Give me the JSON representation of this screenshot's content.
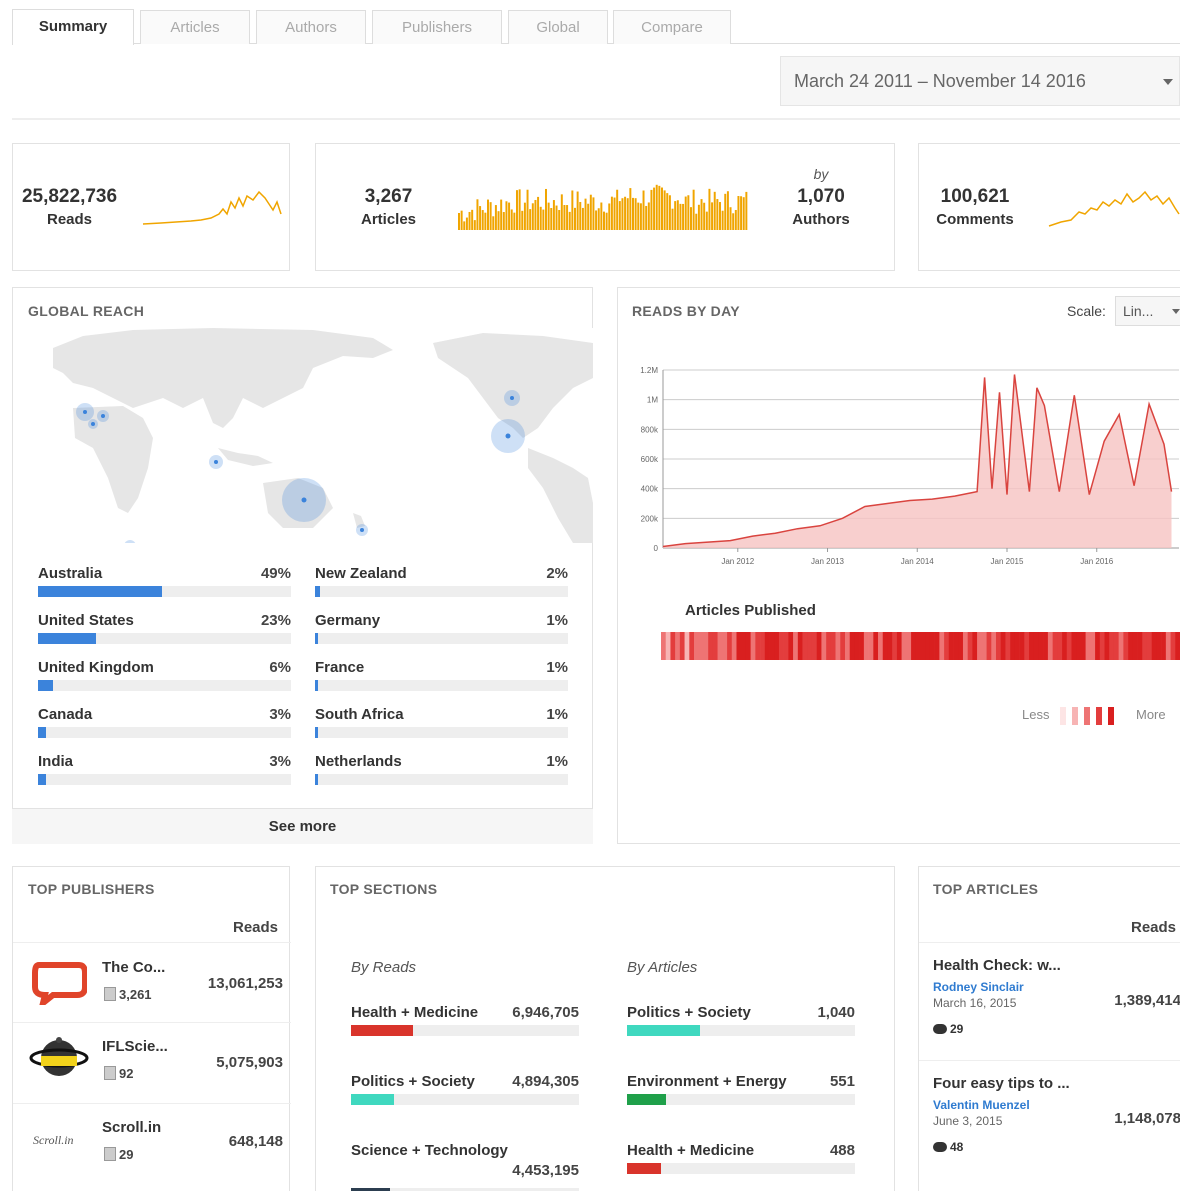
{
  "tabs": [
    "Summary",
    "Articles",
    "Authors",
    "Publishers",
    "Global",
    "Compare"
  ],
  "date_range": "March 24 2011 – November 14 2016",
  "summary": {
    "reads": {
      "value": "25,822,736",
      "label": "Reads"
    },
    "articles": {
      "value": "3,267",
      "label": "Articles"
    },
    "authors": {
      "by": "by",
      "value": "1,070",
      "label": "Authors"
    },
    "comments": {
      "value": "100,621",
      "label": "Comments"
    }
  },
  "colors": {
    "accent_orange": "#f0a500",
    "reads_red": "#d9443f",
    "bar_blue": "#3b83db"
  },
  "global_reach": {
    "title": "GLOBAL REACH",
    "countries": [
      {
        "name": "Australia",
        "pct": "49%",
        "value": 49
      },
      {
        "name": "United States",
        "pct": "23%",
        "value": 23
      },
      {
        "name": "United Kingdom",
        "pct": "6%",
        "value": 6
      },
      {
        "name": "Canada",
        "pct": "3%",
        "value": 3
      },
      {
        "name": "India",
        "pct": "3%",
        "value": 3
      },
      {
        "name": "New Zealand",
        "pct": "2%",
        "value": 2
      },
      {
        "name": "Germany",
        "pct": "1%",
        "value": 1
      },
      {
        "name": "France",
        "pct": "1%",
        "value": 1
      },
      {
        "name": "South Africa",
        "pct": "1%",
        "value": 1
      },
      {
        "name": "Netherlands",
        "pct": "1%",
        "value": 1
      }
    ],
    "see_more": "See more"
  },
  "reads_by_day": {
    "title": "READS BY DAY",
    "scale_label": "Scale:",
    "scale_value": "Lin...",
    "articles_published": "Articles Published",
    "legend_less": "Less",
    "legend_more": "More"
  },
  "chart_data": {
    "type": "area",
    "title": "READS BY DAY",
    "y_ticks": [
      "0",
      "200k",
      "400k",
      "600k",
      "800k",
      "1M",
      "1.2M"
    ],
    "x_ticks": [
      "Jan 2012",
      "Jan 2013",
      "Jan 2014",
      "Jan 2015",
      "Jan 2016"
    ],
    "ylim": [
      0,
      1200000
    ],
    "x": [
      "2011-03",
      "2011-06",
      "2011-09",
      "2011-12",
      "2012-03",
      "2012-06",
      "2012-09",
      "2012-12",
      "2013-03",
      "2013-06",
      "2013-09",
      "2013-12",
      "2014-03",
      "2014-06",
      "2014-09",
      "2014-10",
      "2014-11",
      "2014-12",
      "2015-01",
      "2015-02",
      "2015-04",
      "2015-05",
      "2015-06",
      "2015-08",
      "2015-10",
      "2015-12",
      "2016-02",
      "2016-04",
      "2016-06",
      "2016-08",
      "2016-10",
      "2016-11"
    ],
    "values": [
      10000,
      30000,
      40000,
      50000,
      80000,
      100000,
      130000,
      150000,
      200000,
      280000,
      300000,
      320000,
      330000,
      350000,
      380000,
      1150000,
      400000,
      1050000,
      360000,
      1170000,
      380000,
      1080000,
      960000,
      380000,
      1030000,
      360000,
      720000,
      900000,
      420000,
      970000,
      700000,
      380000
    ]
  },
  "top_publishers": {
    "title": "TOP PUBLISHERS",
    "reads_header": "Reads",
    "items": [
      {
        "name": "The Co...",
        "count": "3,261",
        "reads": "13,061,253"
      },
      {
        "name": "IFLScie...",
        "count": "92",
        "reads": "5,075,903"
      },
      {
        "name": "Scroll.in",
        "count": "29",
        "reads": "648,148",
        "logo_text": "Scroll.in"
      }
    ]
  },
  "top_sections": {
    "title": "TOP SECTIONS",
    "by_reads_label": "By Reads",
    "by_articles_label": "By Articles",
    "by_reads": [
      {
        "name": "Health + Medicine",
        "value": "6,946,705",
        "fraction": 0.27,
        "color": "#d9342b"
      },
      {
        "name": "Politics + Society",
        "value": "4,894,305",
        "fraction": 0.19,
        "color": "#3fd8bf"
      },
      {
        "name": "Science + Technology",
        "value": "4,453,195",
        "fraction": 0.17,
        "color": "#2c3e50"
      }
    ],
    "by_articles": [
      {
        "name": "Politics + Society",
        "value": "1,040",
        "fraction": 0.32,
        "color": "#3fd8bf"
      },
      {
        "name": "Environment + Energy",
        "value": "551",
        "fraction": 0.17,
        "color": "#1fa04a"
      },
      {
        "name": "Health + Medicine",
        "value": "488",
        "fraction": 0.15,
        "color": "#d9342b"
      }
    ]
  },
  "top_articles": {
    "title": "TOP ARTICLES",
    "reads_header": "Reads",
    "items": [
      {
        "title": "Health Check: w...",
        "author": "Rodney Sinclair",
        "date": "March 16, 2015",
        "reads": "1,389,414",
        "comments": "29"
      },
      {
        "title": "Four easy tips to ...",
        "author": "Valentin Muenzel",
        "date": "June 3, 2015",
        "reads": "1,148,078",
        "comments": "48"
      }
    ]
  }
}
